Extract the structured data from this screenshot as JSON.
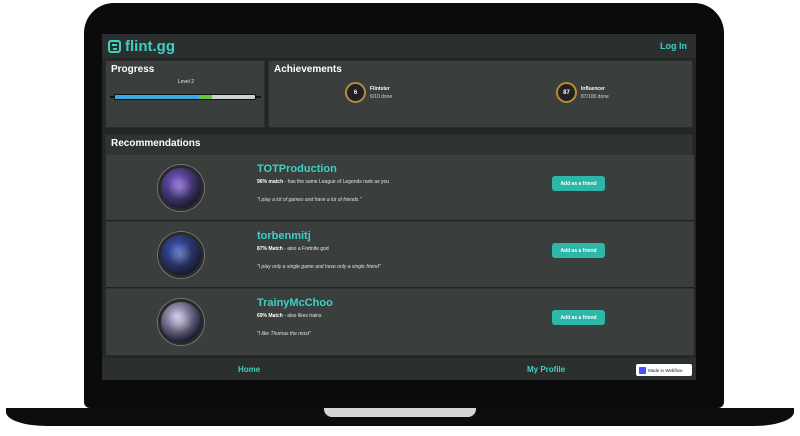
{
  "app": {
    "brand": "flint.gg",
    "login_label": "Log In"
  },
  "progress": {
    "title": "Progress",
    "level_label": "Level 2",
    "fill_fraction": 0.6,
    "highlight_fraction": 0.09
  },
  "achievements": {
    "title": "Achievements",
    "items": [
      {
        "count": "6",
        "name": "Flintster",
        "status": "6/10 done",
        "icon": "flint-ring-icon"
      },
      {
        "count": "87",
        "name": "Influencer",
        "status": "87/100 done",
        "icon": "influencer-ring-icon"
      }
    ]
  },
  "recommendations": {
    "title": "Recommendations",
    "items": [
      {
        "name": "TOTProduction",
        "match_pct": "96% match",
        "reason": " - has the same League of Legends rank as you",
        "quote": "\"I play a lot of games and have a lot of friends.\"",
        "button": "Add as a friend",
        "avatar_color": "#7a5ad0"
      },
      {
        "name": "torbenmitj",
        "match_pct": "87% Match",
        "reason": " - also a Fortnite god",
        "quote": "\"I play only a single game and have only a single friend\"",
        "button": "Add as a friend",
        "avatar_color": "#3b58b8"
      },
      {
        "name": "TrainyMcChoo",
        "match_pct": "69% Match",
        "reason": " - also likes trains",
        "quote": "\"I like Thomas the most\"",
        "button": "Add as a friend",
        "avatar_color": "#c9c4e8"
      }
    ]
  },
  "footer": {
    "home": "Home",
    "profile": "My Profile",
    "badge": "Made in Webflow"
  },
  "colors": {
    "accent": "#3fd0c4",
    "button": "#2db7a9",
    "panel": "#3a3e3d",
    "background": "#222625"
  }
}
